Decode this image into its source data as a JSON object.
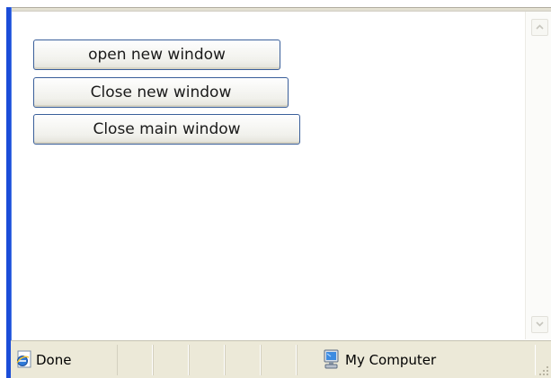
{
  "buttons": {
    "open_new": "open new window",
    "close_new": "Close new window",
    "close_main": "Close main window"
  },
  "statusbar": {
    "status": "Done",
    "zone": "My Computer"
  },
  "icons": {
    "status": "ie-page-icon",
    "zone": "my-computer-icon",
    "scroll_up": "chevron-up-icon",
    "scroll_down": "chevron-down-icon"
  }
}
